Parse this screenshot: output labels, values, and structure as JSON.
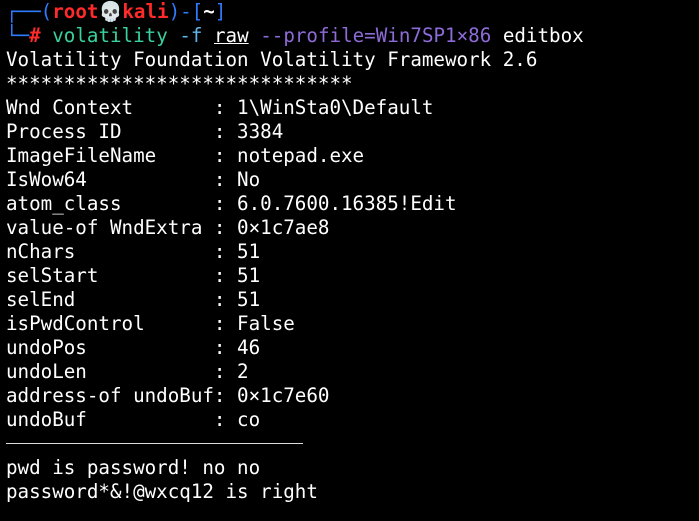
{
  "prompt": {
    "corner_top": "┌──(",
    "user": "root",
    "skull_icon": "💀",
    "host": "kali",
    "mid": ")-[",
    "dir": "~",
    "end": "]",
    "corner_bottom": "└─",
    "hash": "#"
  },
  "command": {
    "program": "volatility",
    "flag": "-f",
    "file": "raw",
    "profile": "--profile=Win7SP1×86",
    "plugin": "editbox"
  },
  "output": {
    "banner": "Volatility Foundation Volatility Framework 2.6",
    "stars": "******************************",
    "rows": [
      "Wnd Context       : 1\\WinSta0\\Default",
      "Process ID        : 3384",
      "ImageFileName     : notepad.exe",
      "IsWow64           : No",
      "atom_class        : 6.0.7600.16385!Edit",
      "value-of WndExtra : 0×1c7ae8",
      "nChars            : 51",
      "selStart          : 51",
      "selEnd            : 51",
      "isPwdControl      : False",
      "undoPos           : 46",
      "undoLen           : 2",
      "address-of undoBuf: 0×1c7e60",
      "undoBuf           : co"
    ],
    "content_lines": [
      "pwd is password! no no",
      "password*&!@wxcq12 is right"
    ]
  },
  "colors": {
    "background": "#000000",
    "prompt_blue": "#2f7bff",
    "prompt_red": "#ff2a2a",
    "command_green": "#3ad0a0",
    "flag_blue": "#5eb7e8",
    "profile_purple": "#8d6bd8"
  }
}
